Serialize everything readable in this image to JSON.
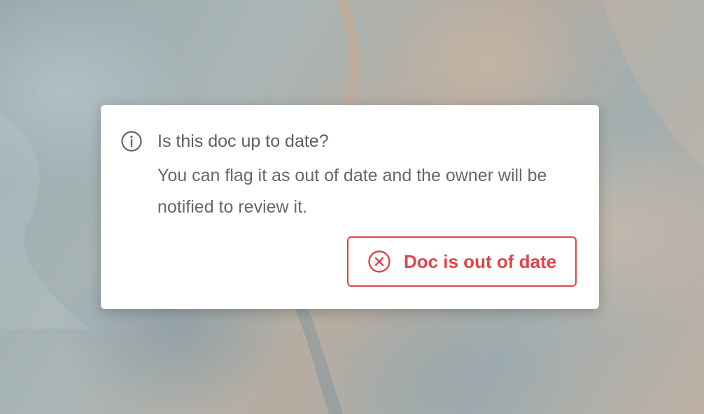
{
  "dialog": {
    "icon": "info-icon",
    "title": "Is this doc up to date?",
    "message": "You can flag it as out of date and the owner will be notified to review it.",
    "button": {
      "icon": "x-circle-icon",
      "label": "Doc is out of date"
    }
  },
  "colors": {
    "accent_red": "#e2434a",
    "text_gray": "#5b5e66",
    "card_background": "#ffffff"
  }
}
